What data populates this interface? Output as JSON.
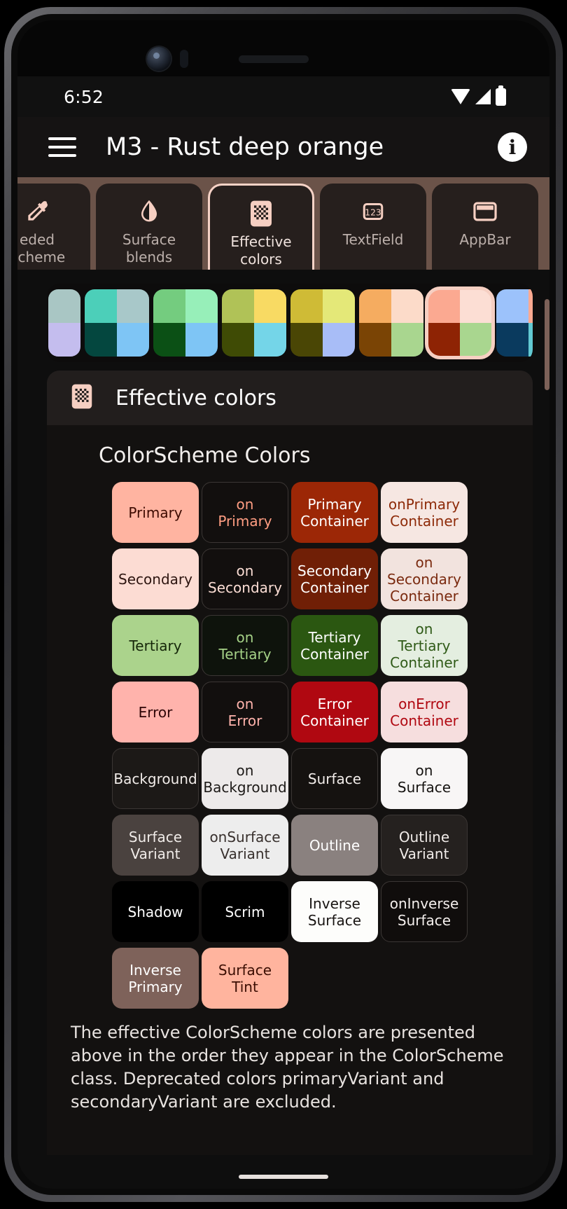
{
  "status_bar": {
    "time": "6:52",
    "icons": [
      "wifi-icon",
      "cellular-signal-icon",
      "battery-icon"
    ]
  },
  "app_bar": {
    "menu_icon": "hamburger-menu-icon",
    "title": "M3 -  Rust deep orange",
    "info_icon": "info-icon",
    "info_glyph": "i"
  },
  "tabs": [
    {
      "id": "seeded-scheme",
      "label": "eded\nScheme",
      "line1": "eded",
      "line2": "Scheme",
      "icon": "eyedropper-icon",
      "selected": false
    },
    {
      "id": "surface-blends",
      "label": "Surface blends",
      "line1": "Surface",
      "line2": "blends",
      "icon": "water-drop-icon",
      "selected": false
    },
    {
      "id": "effective-colors",
      "label": "Effective colors",
      "line1": "Effective",
      "line2": "colors",
      "icon": "palette-grid-icon",
      "selected": true
    },
    {
      "id": "textfield",
      "label": "TextField",
      "line1": "TextField",
      "line2": "",
      "icon": "123-icon",
      "selected": false
    },
    {
      "id": "appbar",
      "label": "AppBar",
      "line1": "AppBar",
      "line2": "",
      "icon": "appbar-icon",
      "selected": false
    }
  ],
  "palette": {
    "selected_index": 6,
    "groups": [
      {
        "clipped": true,
        "swatches": [
          "#a9c6c4",
          "#a9c6c4",
          "#c4bdee",
          "#c4bdee"
        ]
      },
      {
        "clipped": false,
        "swatches": [
          "#4ccfb9",
          "#a8c8c9",
          "#04473f",
          "#7ec5f5"
        ]
      },
      {
        "clipped": false,
        "swatches": [
          "#74cc7f",
          "#97efb9",
          "#0b5015",
          "#7ec5f5"
        ]
      },
      {
        "clipped": false,
        "swatches": [
          "#b0c257",
          "#f8da63",
          "#3f4b05",
          "#74d5e8"
        ]
      },
      {
        "clipped": false,
        "swatches": [
          "#cfbb36",
          "#e4e878",
          "#4a4605",
          "#a8bdf7"
        ]
      },
      {
        "clipped": false,
        "swatches": [
          "#f5ac60",
          "#fcdbc9",
          "#7a4405",
          "#a9d68f"
        ]
      },
      {
        "clipped": false,
        "swatches": [
          "#fba991",
          "#fcded4",
          "#8e2304",
          "#a9d68f"
        ]
      },
      {
        "clipped": false,
        "swatches": [
          "#9cc2fb",
          "#fba991",
          "#0a3a5e",
          "#62c9d2"
        ]
      }
    ]
  },
  "panel": {
    "icon": "palette-grid-icon",
    "title": "Effective colors",
    "section_title": "ColorScheme Colors",
    "footer_note": "The effective ColorScheme colors are presented above in the order they appear in the ColorScheme class. Deprecated colors primaryVariant and secondaryVariant are excluded."
  },
  "chips": [
    {
      "label": "Primary",
      "bg": "#ffb4a1",
      "fg": "#3c0a00",
      "outlined": false
    },
    {
      "label": "on\nPrimary",
      "bg": "#120f0e",
      "fg": "#ff9d82",
      "outlined": true
    },
    {
      "label": "Primary\nContainer",
      "bg": "#9c2706",
      "fg": "#ffffff",
      "outlined": false
    },
    {
      "label": "onPrimary\nContainer",
      "bg": "#f6e7e2",
      "fg": "#8d2a08",
      "outlined": false
    },
    {
      "label": "Secondary",
      "bg": "#fcdcd3",
      "fg": "#2d1510",
      "outlined": false
    },
    {
      "label": "on\nSecondary",
      "bg": "#120f0e",
      "fg": "#fbddd4",
      "outlined": true
    },
    {
      "label": "Secondary\nContainer",
      "bg": "#701f06",
      "fg": "#ffffff",
      "outlined": false
    },
    {
      "label": "on\nSecondary\nContainer",
      "bg": "#f2e3de",
      "fg": "#7a2a0f",
      "outlined": false
    },
    {
      "label": "Tertiary",
      "bg": "#abd38c",
      "fg": "#152609",
      "outlined": false
    },
    {
      "label": "on\nTertiary",
      "bg": "#0e130c",
      "fg": "#a5d187",
      "outlined": true
    },
    {
      "label": "Tertiary\nContainer",
      "bg": "#2b5711",
      "fg": "#ffffff",
      "outlined": false
    },
    {
      "label": "on\nTertiary\nContainer",
      "bg": "#e4eee0",
      "fg": "#2f5a17",
      "outlined": false
    },
    {
      "label": "Error",
      "bg": "#ffb3ac",
      "fg": "#2c0406",
      "outlined": false
    },
    {
      "label": "on\nError",
      "bg": "#120f0e",
      "fg": "#ffb3ac",
      "outlined": true
    },
    {
      "label": "Error\nContainer",
      "bg": "#b00811",
      "fg": "#ffffff",
      "outlined": false
    },
    {
      "label": "onError\nContainer",
      "bg": "#f6dede",
      "fg": "#b00811",
      "outlined": false
    },
    {
      "label": "Background",
      "bg": "#1c1917",
      "fg": "#f1ece9",
      "outlined": true
    },
    {
      "label": "on\nBackground",
      "bg": "#edeaea",
      "fg": "#1c1917",
      "outlined": false
    },
    {
      "label": "Surface",
      "bg": "#151210",
      "fg": "#f1ece9",
      "outlined": true
    },
    {
      "label": "on\nSurface",
      "bg": "#f8f6f6",
      "fg": "#151210",
      "outlined": false
    },
    {
      "label": "Surface\nVariant",
      "bg": "#4a423f",
      "fg": "#f1ece9",
      "outlined": false
    },
    {
      "label": "onSurface\nVariant",
      "bg": "#ededed",
      "fg": "#38302d",
      "outlined": false
    },
    {
      "label": "Outline",
      "bg": "#8a817f",
      "fg": "#ffffff",
      "outlined": false
    },
    {
      "label": "Outline\nVariant",
      "bg": "#25211f",
      "fg": "#f1ece9",
      "outlined": true
    },
    {
      "label": "Shadow",
      "bg": "#000000",
      "fg": "#ffffff",
      "outlined": false
    },
    {
      "label": "Scrim",
      "bg": "#000000",
      "fg": "#ffffff",
      "outlined": false
    },
    {
      "label": "Inverse\nSurface",
      "bg": "#fdfdfb",
      "fg": "#181412",
      "outlined": false
    },
    {
      "label": "onInverse\nSurface",
      "bg": "#100d0c",
      "fg": "#f4efed",
      "outlined": true
    },
    {
      "label": "Inverse\nPrimary",
      "bg": "#7e625a",
      "fg": "#ffffff",
      "outlined": false
    },
    {
      "label": "Surface\nTint",
      "bg": "#ffb49e",
      "fg": "#3a0d02",
      "outlined": false
    }
  ]
}
